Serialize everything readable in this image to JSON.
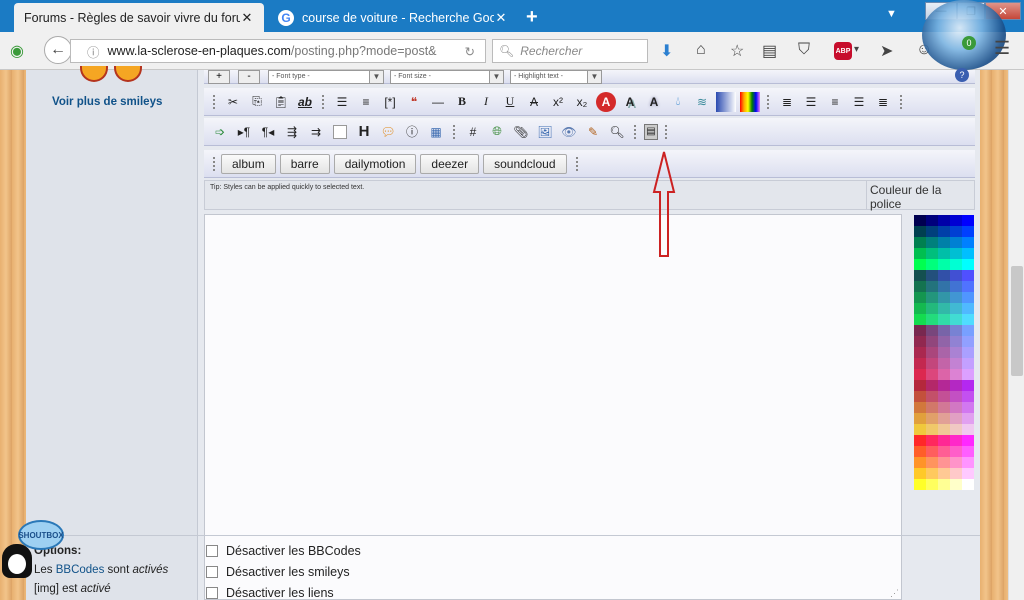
{
  "tabs": [
    {
      "title": "Forums - Règles de savoir vivre du foru...",
      "close": "✕"
    },
    {
      "title": "course de voiture - Recherche Goo...",
      "close": "✕"
    }
  ],
  "new_tab": "+",
  "url": {
    "domain": "www.la-sclerose-en-plaques.com",
    "path": "/posting.php?mode=post&"
  },
  "search_placeholder": "Rechercher",
  "addon_badge": "0",
  "abp_label": "ABP",
  "window_controls": {
    "minimize": "—",
    "restore": "❐",
    "close": "✕"
  },
  "sidebar": {
    "more_smileys": "Voir plus de smileys"
  },
  "toolbar": {
    "font_type": "- Font type -",
    "font_size": "- Font size -",
    "highlight": "- Highlight text -",
    "plus": "+",
    "minus": "-",
    "icons": [
      "scissors-icon",
      "copy-icon",
      "paste-icon",
      "spellcheck-icon",
      "bullet-list-icon",
      "numbered-list-icon",
      "list-item-icon",
      "quote-icon",
      "horizontal-rule-icon",
      "bold-icon",
      "italic-icon",
      "underline-icon",
      "strike-icon",
      "superscript-icon",
      "subscript-icon",
      "font-color-icon",
      "shadow-text-icon",
      "glow-text-icon",
      "dropper-icon",
      "wave-icon",
      "gradient-icon",
      "rainbow-icon",
      "align-justify-icon",
      "align-left-icon",
      "align-center-icon",
      "align-right-icon"
    ],
    "row2_icons": [
      "insert-icon",
      "ltr-icon",
      "rtl-icon",
      "indent-icon",
      "outdent-icon",
      "blank-box-icon",
      "heading-icon",
      "speech-bubble-icon",
      "info-icon",
      "table-icon",
      "code-icon",
      "globe-link-icon",
      "attachment-icon",
      "image-icon",
      "media-icon",
      "highlighter-icon",
      "search-icon",
      "film-icon"
    ],
    "tags": [
      "album",
      "barre",
      "dailymotion",
      "deezer",
      "soundcloud"
    ]
  },
  "tip": "Tip: Styles can be applied quickly to selected text.",
  "color_label": "Couleur de la police",
  "options": {
    "heading": "Options:",
    "bbcode_prefix": "Les ",
    "bbcode_link": "BBCodes",
    "bbcode_mid": " sont ",
    "bbcode_state": "activés",
    "img_text": "[img] est ",
    "img_state": "activé"
  },
  "checkboxes": [
    "Désactiver les BBCodes",
    "Désactiver les smileys",
    "Désactiver les liens"
  ],
  "shoutbox_label": "SHOUTBOX",
  "colors": {
    "accent": "#1b7bc4",
    "link": "#105289",
    "arrow": "#cc2222"
  }
}
